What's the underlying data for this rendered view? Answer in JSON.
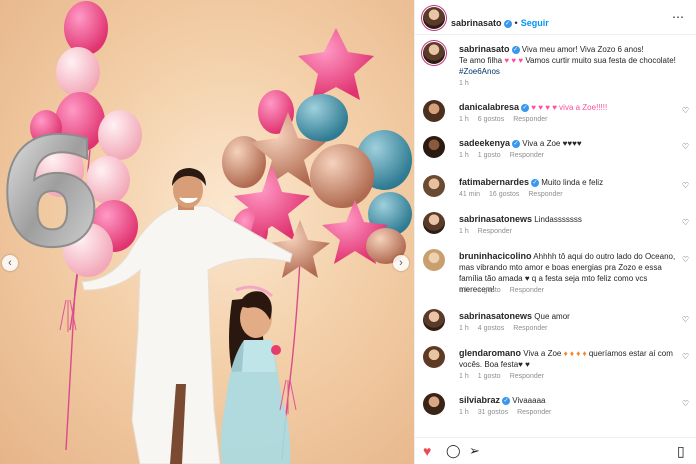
{
  "post": {
    "author": "sabrinasato",
    "follow_label": "Seguir",
    "separator": "•",
    "more_icon": "⋯",
    "caption_user": "sabrinasato",
    "caption_text_1": "Viva meu amor! Viva Zozo 6 anos!",
    "caption_text_2": "Te amo filha",
    "caption_text_3": "Vamos curtir muito sua festa de chocolate!",
    "caption_hashtag": "#Zoe6Anos",
    "caption_time": "1 h"
  },
  "photo": {
    "number_balloon": "6",
    "prev_icon": "‹",
    "next_icon": "›"
  },
  "comments": [
    {
      "user": "danicalabresa",
      "verified": true,
      "text": "♥ ♥ ♥ ♥ viva a Zoe!!!!!",
      "time": "1 h",
      "likes": "6 gostos",
      "reply": "Responder"
    },
    {
      "user": "sadeekenya",
      "verified": true,
      "text": "Viva a Zoe ♥♥♥♥",
      "time": "1 h",
      "likes": "1 gosto",
      "reply": "Responder"
    },
    {
      "user": "fatimabernardes",
      "verified": true,
      "text": "Muito linda e feliz",
      "time": "41 min",
      "likes": "16 gostos",
      "reply": "Responder"
    },
    {
      "user": "sabrinasatonews",
      "verified": false,
      "text": "Lindasssssss",
      "time": "1 h",
      "likes": "",
      "reply": "Responder"
    },
    {
      "user": "bruninhacicolino",
      "verified": false,
      "text": "Ahhhh tô aqui do outro lado do Oceano, mas vibrando mto amor e boas energias pra Zozo e essa família tão amada ♥ q a festa seja mto feliz como vcs merecem!",
      "time": "1 h",
      "likes": "1 gosto",
      "reply": "Responder"
    },
    {
      "user": "sabrinasatonews",
      "verified": false,
      "text": "Que amor",
      "time": "1 h",
      "likes": "4 gostos",
      "reply": "Responder"
    },
    {
      "user": "glendaromano",
      "verified": false,
      "text": "Viva a Zoe",
      "text_2": "queríamos estar aí com vocês. Boa festa♥ ♥",
      "time": "1 h",
      "likes": "1 gosto",
      "reply": "Responder"
    },
    {
      "user": "silviabraz",
      "verified": true,
      "text": "Vivaaaaa",
      "time": "1 h",
      "likes": "31 gostos",
      "reply": "Responder"
    }
  ],
  "actions": {
    "like_icon": "♥",
    "comment_icon": "◯",
    "share_icon": "➢",
    "save_icon": "▯"
  },
  "colors": {
    "accent_blue": "#0095f6",
    "heart_red": "#ed4956",
    "verified": "#3897f0"
  }
}
